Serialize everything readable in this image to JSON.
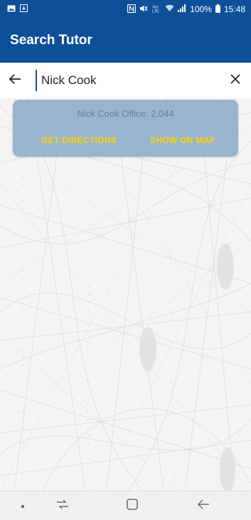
{
  "status_bar": {
    "battery": "100%",
    "time": "15:48",
    "icons": [
      "gallery-icon",
      "download-icon",
      "nfc-icon",
      "mute-icon",
      "volte-icon",
      "wifi-icon",
      "signal-icon",
      "battery-icon"
    ]
  },
  "app_bar": {
    "title": "Search Tutor"
  },
  "search": {
    "value": "Nick Cook"
  },
  "info_card": {
    "text": "Nick Cook Office: 2.044",
    "directions_label": "GET DIRECTIONS",
    "map_label": "SHOW ON MAP"
  },
  "colors": {
    "primary": "#0d4f99",
    "card": "#99b4cf",
    "accent": "#ffd200"
  },
  "nav_bar": {
    "icons": [
      "dot-icon",
      "recent-apps-icon",
      "home-icon",
      "back-icon"
    ]
  }
}
